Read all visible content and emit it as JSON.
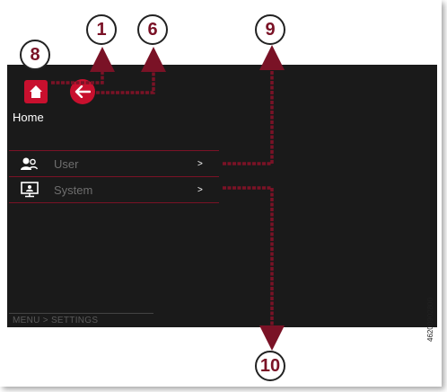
{
  "screen": {
    "home": {
      "label": "Home",
      "icon": "home-icon"
    },
    "back": {
      "icon": "back-arrow-icon"
    },
    "menu": [
      {
        "label": "User",
        "icon": "users-icon",
        "chevron": ">"
      },
      {
        "label": "System",
        "icon": "monitor-icon",
        "chevron": ">"
      }
    ],
    "breadcrumb": "MENU > SETTINGS"
  },
  "callouts": {
    "c1": "1",
    "c6": "6",
    "c8": "8",
    "c9": "9",
    "c10": "10"
  },
  "part_number": "46200902800",
  "colors": {
    "accent": "#c8102e",
    "callout_text": "#7a1226",
    "leader": "#7a1226",
    "screen_bg": "#1a1a1a"
  }
}
